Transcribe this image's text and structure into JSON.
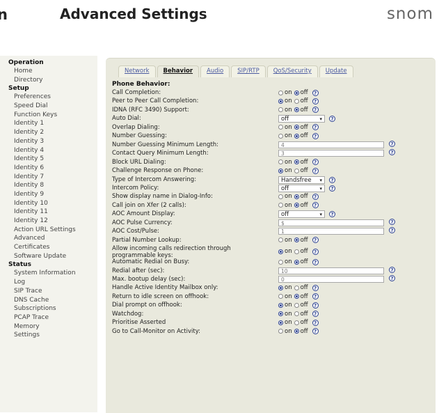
{
  "header": {
    "edge_char": "n",
    "title": "Advanced Settings",
    "logo": "snom"
  },
  "sidebar": [
    {
      "section": "Operation",
      "items": [
        "Home",
        "Directory"
      ]
    },
    {
      "section": "Setup",
      "items": [
        "Preferences",
        "Speed Dial",
        "Function Keys",
        "Identity 1",
        "Identity 2",
        "Identity 3",
        "Identity 4",
        "Identity 5",
        "Identity 6",
        "Identity 7",
        "Identity 8",
        "Identity 9",
        "Identity 10",
        "Identity 11",
        "Identity 12",
        "Action URL Settings",
        "Advanced",
        "Certificates",
        "Software Update"
      ]
    },
    {
      "section": "Status",
      "items": [
        "System Information",
        "Log",
        "SIP Trace",
        "DNS Cache",
        "Subscriptions",
        "PCAP Trace",
        "Memory",
        "Settings"
      ]
    }
  ],
  "tabs": [
    {
      "label": "Network",
      "active": false
    },
    {
      "label": "Behavior",
      "active": true
    },
    {
      "label": "Audio",
      "active": false
    },
    {
      "label": "SIP/RTP",
      "active": false
    },
    {
      "label": "QoS/Security",
      "active": false
    },
    {
      "label": "Update",
      "active": false
    }
  ],
  "section_title": "Phone Behavior:",
  "radio_labels": {
    "on": "on",
    "off": "off"
  },
  "help_glyph": "?",
  "settings": [
    {
      "label": "Call Completion:",
      "type": "radio",
      "value": "off"
    },
    {
      "label": "Peer to Peer Call Completion:",
      "type": "radio",
      "value": "on"
    },
    {
      "label": "IDNA (RFC 3490) Support:",
      "type": "radio",
      "value": "off"
    },
    {
      "label": "Auto Dial:",
      "type": "select",
      "value": "off"
    },
    {
      "label": "Overlap Dialing:",
      "type": "radio",
      "value": "off"
    },
    {
      "label": "Number Guessing:",
      "type": "radio",
      "value": "off"
    },
    {
      "label": "Number Guessing Minimum Length:",
      "type": "text",
      "value": "4"
    },
    {
      "label": "Contact Query Minimum Length:",
      "type": "text",
      "value": "3"
    },
    {
      "label": "Block URL Dialing:",
      "type": "radio",
      "value": "off"
    },
    {
      "label": "Challenge Response on Phone:",
      "type": "radio",
      "value": "on"
    },
    {
      "label": "Type of Intercom Answering:",
      "type": "select",
      "value": "Handsfree"
    },
    {
      "label": "Intercom Policy:",
      "type": "select",
      "value": "off"
    },
    {
      "label": "Show display name in Dialog-Info:",
      "type": "radio",
      "value": "off"
    },
    {
      "label": "Call join on Xfer (2 calls):",
      "type": "radio",
      "value": "off"
    },
    {
      "label": "AOC Amount Display:",
      "type": "select",
      "value": "off"
    },
    {
      "label": "AOC Pulse Currency:",
      "type": "text",
      "value": "$"
    },
    {
      "label": "AOC Cost/Pulse:",
      "type": "text",
      "value": "1"
    },
    {
      "label": "Partial Number Lookup:",
      "type": "radio",
      "value": "off"
    },
    {
      "label": "Allow incoming calls redirection through programmable keys:",
      "type": "radio",
      "value": "on"
    },
    {
      "label": "Automatic Redial on Busy:",
      "type": "radio",
      "value": "off"
    },
    {
      "label": "Redial after (sec):",
      "type": "text",
      "value": "10"
    },
    {
      "label": "Max. bootup delay (sec):",
      "type": "text",
      "value": "0"
    },
    {
      "label": "Handle Active Identity Mailbox only:",
      "type": "radio",
      "value": "on"
    },
    {
      "label": "Return to idle screen on offhook:",
      "type": "radio",
      "value": "off"
    },
    {
      "label": "Dial prompt on offhook:",
      "type": "radio",
      "value": "on"
    },
    {
      "label": "Watchdog:",
      "type": "radio",
      "value": "on"
    },
    {
      "label": "Prioritise Asserted",
      "type": "radio",
      "value": "on"
    },
    {
      "label": "Go to Call-Monitor on Activity:",
      "type": "radio",
      "value": "off"
    }
  ]
}
